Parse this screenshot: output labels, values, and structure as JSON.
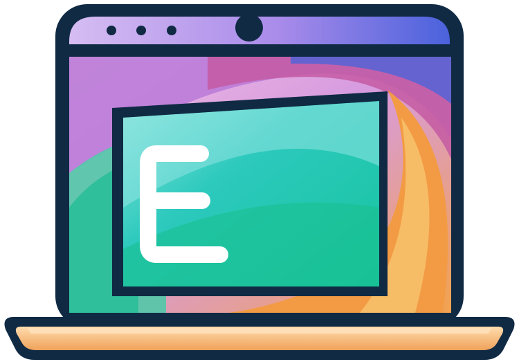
{
  "icon": {
    "name": "laptop-icon",
    "letter": "E"
  },
  "colors": {
    "outline": "#102a44",
    "titlebar_left": "#cdb3ee",
    "titlebar_right": "#4c63dc",
    "wallpaper_pink": "#eab2dc",
    "wallpaper_purple": "#a568cf",
    "wallpaper_magenta": "#c0509a",
    "wallpaper_orange": "#f0a04a",
    "wallpaper_teal": "#3cc7a8",
    "window_teal": "#1ec6b4",
    "window_light": "#9fe8e0",
    "base_light": "#ffd2a0",
    "base_dark": "#f1a55a"
  }
}
